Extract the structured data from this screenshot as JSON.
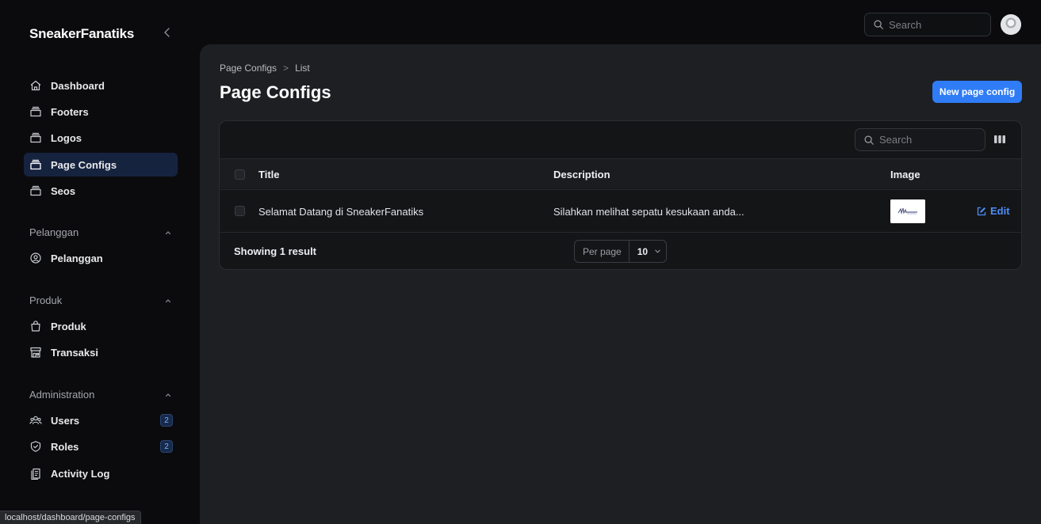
{
  "app": {
    "brand": "SneakerFanatiks"
  },
  "topbar": {
    "search_placeholder": "Search"
  },
  "sidebar": {
    "main_items": [
      {
        "label": "Dashboard",
        "icon": "home-icon"
      },
      {
        "label": "Footers",
        "icon": "stack-icon"
      },
      {
        "label": "Logos",
        "icon": "stack-icon"
      },
      {
        "label": "Page Configs",
        "icon": "stack-icon",
        "active": true
      },
      {
        "label": "Seos",
        "icon": "stack-icon"
      }
    ],
    "groups": [
      {
        "label": "Pelanggan",
        "items": [
          {
            "label": "Pelanggan",
            "icon": "user-circle-icon"
          }
        ]
      },
      {
        "label": "Produk",
        "items": [
          {
            "label": "Produk",
            "icon": "shopping-bag-icon"
          },
          {
            "label": "Transaksi",
            "icon": "storefront-icon"
          }
        ]
      },
      {
        "label": "Administration",
        "items": [
          {
            "label": "Users",
            "icon": "users-icon",
            "badge": "2"
          },
          {
            "label": "Roles",
            "icon": "shield-check-icon",
            "badge": "2"
          },
          {
            "label": "Activity Log",
            "icon": "clipboard-icon"
          }
        ]
      }
    ]
  },
  "main": {
    "breadcrumb": [
      "Page Configs",
      "List"
    ],
    "breadcrumb_separator": ">",
    "title": "Page Configs",
    "new_button_label": "New page config",
    "table": {
      "search_placeholder": "Search",
      "columns": [
        "Title",
        "Description",
        "Image"
      ],
      "rows": [
        {
          "title": "Selamat Datang di SneakerFanatiks",
          "description": "Silahkan melihat sepatu kesukaan anda...",
          "action": "Edit"
        }
      ],
      "footer": {
        "showing_text": "Showing 1 result",
        "per_page_label": "Per page",
        "per_page_value": "10"
      }
    }
  },
  "statusbar": {
    "url": "localhost/dashboard/page-configs"
  },
  "colors": {
    "accent": "#2f7cf6",
    "link": "#4d8ef8",
    "active_nav_bg": "#16233f",
    "panel_bg": "#1e1f22",
    "page_bg": "#0b0b0d"
  }
}
